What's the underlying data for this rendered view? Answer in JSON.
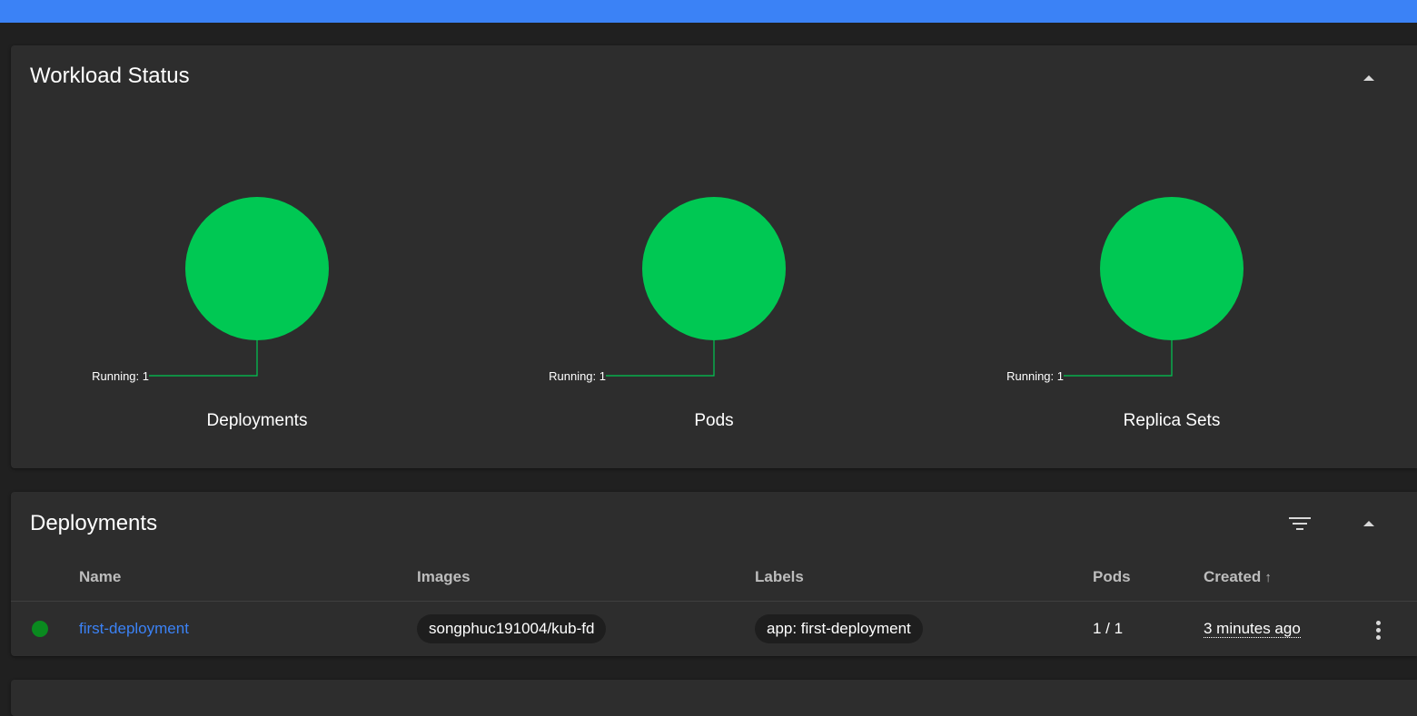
{
  "colors": {
    "accent": "#3b82f6",
    "success": "#00c853",
    "status_dot": "#0a8a1f",
    "card_bg": "#2d2d2d",
    "page_bg": "#202020"
  },
  "workload_status": {
    "title": "Workload Status",
    "charts": [
      {
        "label": "Deployments",
        "legend": "Running: 1",
        "running": 1
      },
      {
        "label": "Pods",
        "legend": "Running: 1",
        "running": 1
      },
      {
        "label": "Replica Sets",
        "legend": "Running: 1",
        "running": 1
      }
    ]
  },
  "deployments": {
    "title": "Deployments",
    "columns": {
      "name": "Name",
      "images": "Images",
      "labels": "Labels",
      "pods": "Pods",
      "created": "Created",
      "sort_indicator": "↑"
    },
    "rows": [
      {
        "status": "running",
        "name": "first-deployment",
        "image": "songphuc191004/kub-fd",
        "label": "app: first-deployment",
        "pods": "1 / 1",
        "created": "3 minutes ago"
      }
    ]
  }
}
